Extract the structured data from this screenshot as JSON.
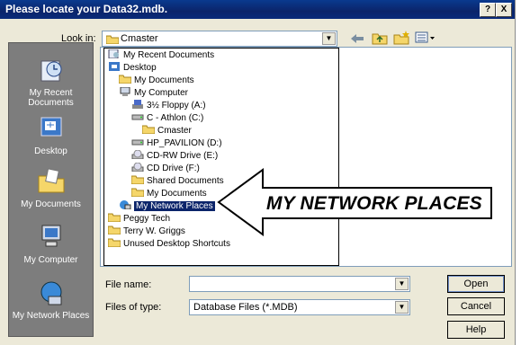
{
  "window": {
    "title": "Please locate your Data32.mdb.",
    "help_label": "?",
    "close_label": "X"
  },
  "lookin": {
    "label": "Look in:",
    "value": "Cmaster"
  },
  "places": [
    {
      "label": "My Recent Documents"
    },
    {
      "label": "Desktop"
    },
    {
      "label": "My Documents"
    },
    {
      "label": "My Computer"
    },
    {
      "label": "My Network Places"
    }
  ],
  "dropdown": [
    {
      "label": "My Recent Documents",
      "icon": "recent-icon"
    },
    {
      "label": "Desktop",
      "icon": "desktop-icon"
    },
    {
      "label": "My Documents",
      "icon": "folder-icon"
    },
    {
      "label": "My Computer",
      "icon": "computer-icon"
    },
    {
      "label": "3½ Floppy (A:)",
      "icon": "floppy-icon"
    },
    {
      "label": "C - Athlon (C:)",
      "icon": "drive-icon"
    },
    {
      "label": "Cmaster",
      "icon": "folder-icon"
    },
    {
      "label": "HP_PAVILION (D:)",
      "icon": "drive-icon"
    },
    {
      "label": "CD-RW Drive (E:)",
      "icon": "cd-icon"
    },
    {
      "label": "CD Drive (F:)",
      "icon": "cd-icon"
    },
    {
      "label": "Shared Documents",
      "icon": "folder-icon"
    },
    {
      "label": "My Documents",
      "icon": "folder-icon"
    },
    {
      "label": "My Network Places",
      "icon": "network-icon"
    },
    {
      "label": "Peggy Tech",
      "icon": "folder-icon"
    },
    {
      "label": "Terry W. Griggs",
      "icon": "folder-icon"
    },
    {
      "label": "Unused Desktop Shortcuts",
      "icon": "folder-icon"
    }
  ],
  "filename": {
    "label": "File name:",
    "value": ""
  },
  "filetype": {
    "label": "Files of type:",
    "value": "Database Files (*.MDB)"
  },
  "buttons": {
    "open": "Open",
    "cancel": "Cancel",
    "help": "Help"
  },
  "callout": {
    "text": "MY NETWORK PLACES"
  },
  "colors": {
    "title_bar": "#0b246a",
    "dialog_bg": "#ece9d8",
    "places_bar": "#7d7d7d",
    "selection": "#0b246a"
  }
}
